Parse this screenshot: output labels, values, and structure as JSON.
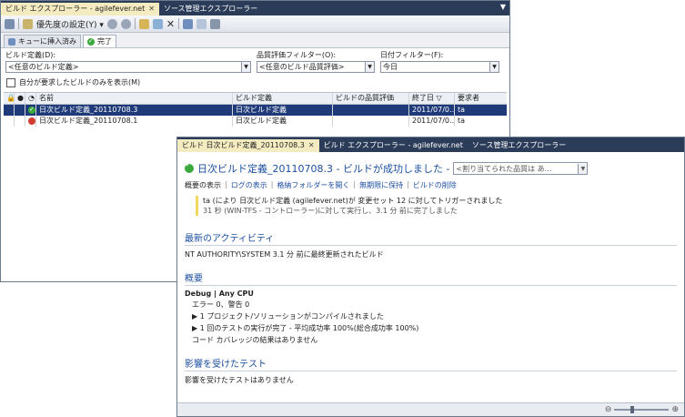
{
  "back": {
    "tabs": [
      {
        "label": "ビルド エクスプローラー - agilefever.net",
        "active": true
      },
      {
        "label": "ソース管理エクスプローラー",
        "active": false
      }
    ],
    "toolbar": {
      "priority_label": "優先度の設定(Y)"
    },
    "subtabs": [
      {
        "label": "キューに挿入済み",
        "active": false
      },
      {
        "label": "完了",
        "active": true
      }
    ],
    "filters": {
      "build_def": {
        "label": "ビルド定義(D):",
        "value": "<任意のビルド定義>"
      },
      "quality": {
        "label": "品質評価フィルター(O):",
        "value": "<任意のビルド品質評価>"
      },
      "date": {
        "label": "日付フィルター(F):",
        "value": "今日"
      }
    },
    "checkbox_label": "自分が要求したビルドのみを表示(M)",
    "grid": {
      "headers": {
        "name": "名前",
        "definition": "ビルド定義",
        "quality": "ビルドの品質評価",
        "end": "終了日",
        "requester": "要求者"
      },
      "rows": [
        {
          "name": "日次ビルド定義_20110708.3",
          "definition": "日次ビルド定義",
          "quality": "",
          "end": "2011/07/0...",
          "requester": "ta",
          "status": "success",
          "selected": true
        },
        {
          "name": "日次ビルド定義_20110708.1",
          "definition": "日次ビルド定義",
          "quality": "",
          "end": "2011/07/0...",
          "requester": "ta",
          "status": "failed",
          "selected": false
        }
      ]
    }
  },
  "front": {
    "tabs": [
      {
        "label": "ビルド 日次ビルド定義_20110708.3",
        "active": true
      },
      {
        "label": "ビルド エクスプローラー - agilefever.net",
        "active": false
      },
      {
        "label": "ソース管理エクスプローラー",
        "active": false
      }
    ],
    "status_text": "日次ビルド定義_20110708.3 - ビルドが成功しました -",
    "quality_placeholder": "<割り当てられた品質は あ…",
    "links": [
      "概要の表示",
      "ログの表示",
      "格納フォルダーを開く",
      "無期限に保持",
      "ビルドの削除"
    ],
    "trigger": {
      "line1": "ta (により 日次ビルド定義 (agilefever.net)が 変更セット 12 に対してトリガーされました",
      "line2": "31 秒 (WIN-TFS - コントローラー)に対して実行し、3.1 分 前に完了しました"
    },
    "activity": {
      "title": "最新のアクティビティ",
      "text": "NT AUTHORITY\\SYSTEM 3.1 分 前に最終更新されたビルド"
    },
    "summary": {
      "title": "概要",
      "config": "Debug | Any CPU",
      "errors": "エラー 0、警告 0",
      "bullet1": "1 プロジェクト/ソリューションがコンパイルされました",
      "bullet2": "1 回のテストの実行が完了 - 平均成功率 100%(総合成功率 100%)",
      "coverage": "コード カバレッジの結果はありません"
    },
    "tests": {
      "title": "影響を受けたテスト",
      "text": "影響を受けたテストはありません"
    }
  },
  "colors": {
    "tab_bg": "#2b3c59",
    "active_tab": "#f4ecc0",
    "selection": "#1f3a78",
    "link": "#1c4fa0",
    "success": "#3aa83a",
    "failure": "#d23b2e"
  }
}
